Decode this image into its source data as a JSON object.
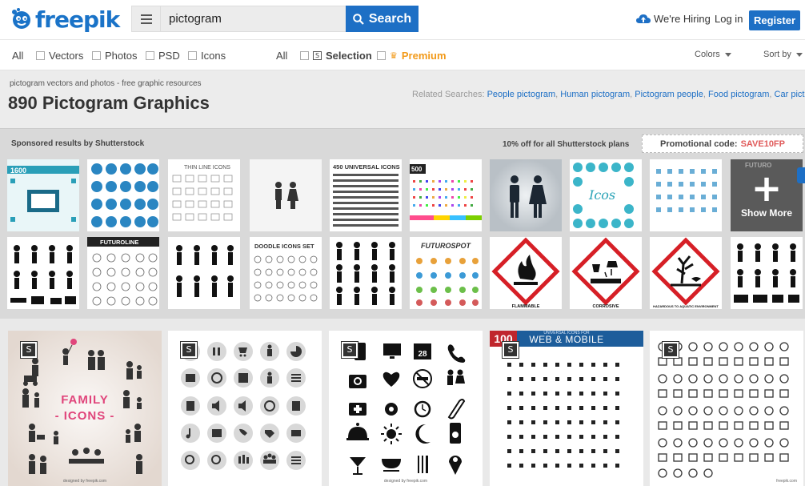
{
  "header": {
    "logo_text": "freepik",
    "search_value": "pictogram",
    "search_button": "Search",
    "hiring": "We're Hiring",
    "login": "Log in",
    "register": "Register",
    "brand_color": "#1d6fc5"
  },
  "filters": {
    "left": [
      {
        "label": "All",
        "checkbox": false
      },
      {
        "label": "Vectors",
        "checkbox": true
      },
      {
        "label": "Photos",
        "checkbox": true
      },
      {
        "label": "PSD",
        "checkbox": true
      },
      {
        "label": "Icons",
        "checkbox": true
      }
    ],
    "middle": {
      "all": "All",
      "selection": "Selection",
      "premium": "Premium"
    },
    "colors": "Colors",
    "sort": "Sort by"
  },
  "summary": {
    "breadcrumb": "pictogram vectors and photos - free graphic resources",
    "title": "890 Pictogram Graphics",
    "related_label": "Related Searches:",
    "related": [
      "People pictogram",
      "Human pictogram",
      "Pictogram people",
      "Food pictogram",
      "Car pictogram"
    ]
  },
  "sponsored": {
    "label": "Sponsored results by Shutterstock",
    "offer": "10% off for all Shutterstock plans",
    "promo_label": "Promotional code:",
    "promo_code": "SAVE10FP",
    "show_more": "Show More",
    "row1": [
      "1600",
      "",
      "THIN LINE ICONS",
      "",
      "450 UNIVERSAL ICONS",
      "500",
      "",
      "",
      "",
      "FUTURO"
    ],
    "row2": [
      "",
      "FUTUROLINE",
      "",
      "DOODLE ICONS SET",
      "",
      "FUTUROSPOT",
      "FLAMMABLE",
      "CORROSIVE",
      "HAZARDOUS TO AQUATIC ENVIRONMENT",
      ""
    ]
  },
  "results": {
    "badge": "S",
    "family_line1": "FAMILY",
    "family_line2": "- ICONS -",
    "web_top": "UNIVERSAL ICONS FOR",
    "web_title": "WEB & MOBILE",
    "web_num": "100",
    "calendar_day": "28",
    "credit_designed": "designed by freepik.com",
    "credit_freepik": "freepik.com"
  }
}
